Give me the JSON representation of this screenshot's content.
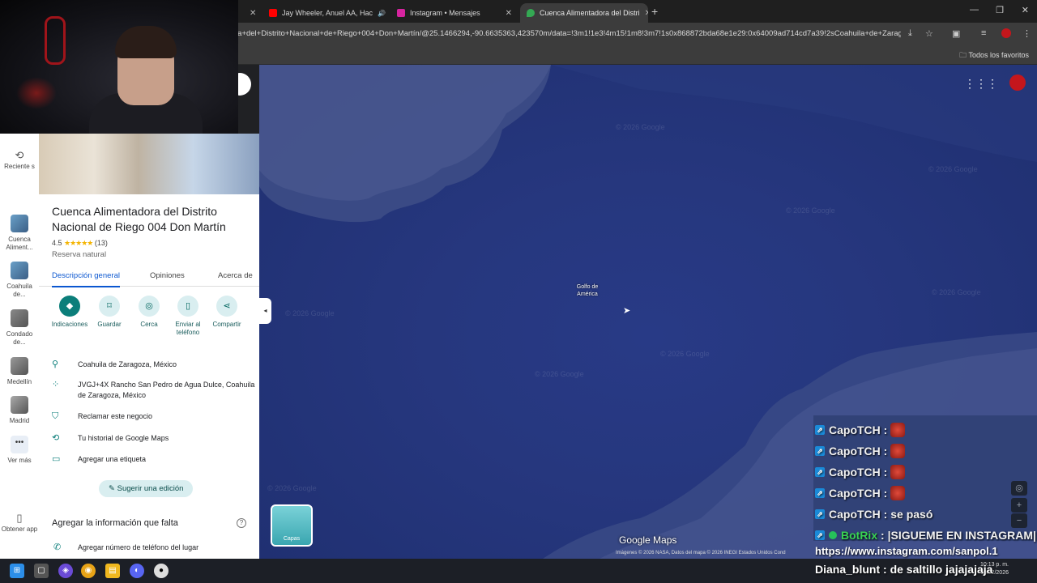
{
  "browser": {
    "tabs": [
      {
        "label": "Jay Wheeler, Anuel AA, Hac",
        "icon": "youtube-icon",
        "color": "#ff0000"
      },
      {
        "label": "Instagram • Mensajes",
        "icon": "instagram-icon",
        "color": "#d6249f"
      },
      {
        "label": "Cuenca Alimentadora del Distri",
        "icon": "maps-pin-icon",
        "color": "#34a853"
      }
    ],
    "url": "ra+del+Distrito+Nacional+de+Riego+004+Don+Martín/@25.1466294,-90.6635363,423570m/data=!3m1!1e3!4m15!1m8!3m7!1s0x868872bda68e1e29:0x64009ad714cd7a39!2sCoahuila+de+Zaragoza...",
    "bookmarks_label": "Todos los favoritos"
  },
  "rail": {
    "recent_label": "Reciente s",
    "items": [
      {
        "label": "Cuenca Aliment..."
      },
      {
        "label": "Coahuila de..."
      },
      {
        "label": "Condado de..."
      },
      {
        "label": "Medellín"
      },
      {
        "label": "Madrid"
      }
    ],
    "more_label": "Ver más",
    "get_app_label": "Obtener app"
  },
  "place": {
    "title": "Cuenca Alimentadora del Distrito Nacional de Riego 004 Don Martín",
    "rating": "4.5",
    "stars": "★★★★★",
    "reviews": "(13)",
    "category": "Reserva natural",
    "tabs": [
      "Descripción general",
      "Opiniones",
      "Acerca de"
    ],
    "actions": [
      "Indicaciones",
      "Guardar",
      "Cerca",
      "Enviar al teléfono",
      "Compartir"
    ],
    "info": [
      {
        "icon": "location-pin-icon",
        "text": "Coahuila de Zaragoza, México"
      },
      {
        "icon": "plus-code-icon",
        "text": "JVGJ+4X Rancho San Pedro de Agua Dulce, Coahuila de Zaragoza, México"
      },
      {
        "icon": "shield-check-icon",
        "text": "Reclamar este negocio"
      },
      {
        "icon": "history-icon",
        "text": "Tu historial de Google Maps"
      },
      {
        "icon": "label-icon",
        "text": "Agregar una etiqueta"
      }
    ],
    "suggest_edit": "Sugerir una edición",
    "missing_title": "Agregar la información que falta",
    "add_phone": "Agregar número de teléfono del lugar"
  },
  "map": {
    "label": "Golfo de América",
    "brand": "Google Maps",
    "attribution": "Imágenes © 2026 NASA, Datos del mapa © 2026 INEGI    Estados Unidos    Cond",
    "layers_label": "Capas",
    "watermarks": [
      "© 2026 Google",
      "© 2026 Google",
      "© 2026 Google",
      "© 2026 Google",
      "© 2026 Google",
      "© 2026 Google",
      "© 2026 Google",
      "© 2026 Google"
    ]
  },
  "chat": {
    "messages": [
      {
        "user": "CapoTCH",
        "text": ""
      },
      {
        "user": "CapoTCH",
        "text": ""
      },
      {
        "user": "CapoTCH",
        "text": ""
      },
      {
        "user": "CapoTCH",
        "text": ""
      },
      {
        "user": "CapoTCH",
        "text": "se pasó"
      },
      {
        "user": "BotRix",
        "text": "|SIGUEME EN INSTAGRAM|"
      }
    ],
    "link": "https://www.instagram.com/sanpol.1",
    "last": {
      "user": "Diana_blunt",
      "text": "de saltillo jajajajaja"
    }
  },
  "taskbar": {
    "time": "10:13 p. m.",
    "date": "19/02/2026"
  }
}
